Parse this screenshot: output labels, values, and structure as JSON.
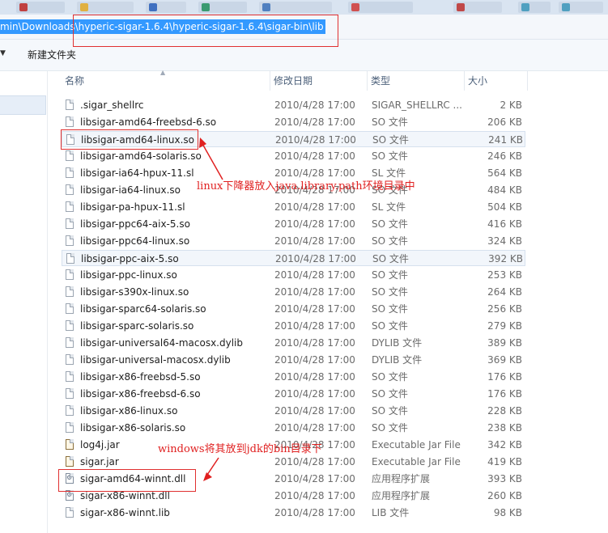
{
  "address": {
    "path": "min\\Downloads\\hyperic-sigar-1.6.4\\hyperic-sigar-1.6.4\\sigar-bin\\lib"
  },
  "toolbar": {
    "new_folder_label": "新建文件夹"
  },
  "columns": {
    "name": "名称",
    "date": "修改日期",
    "type": "类型",
    "size": "大小"
  },
  "files": [
    {
      "name": ".sigar_shellrc",
      "date": "2010/4/28 17:00",
      "type": "SIGAR_SHELLRC ...",
      "size": "2 KB"
    },
    {
      "name": "libsigar-amd64-freebsd-6.so",
      "date": "2010/4/28 17:00",
      "type": "SO 文件",
      "size": "206 KB"
    },
    {
      "name": "libsigar-amd64-linux.so",
      "date": "2010/4/28 17:00",
      "type": "SO 文件",
      "size": "241 KB"
    },
    {
      "name": "libsigar-amd64-solaris.so",
      "date": "2010/4/28 17:00",
      "type": "SO 文件",
      "size": "246 KB"
    },
    {
      "name": "libsigar-ia64-hpux-11.sl",
      "date": "2010/4/28 17:00",
      "type": "SL 文件",
      "size": "564 KB"
    },
    {
      "name": "libsigar-ia64-linux.so",
      "date": "2010/4/28 17:00",
      "type": "SO 文件",
      "size": "484 KB"
    },
    {
      "name": "libsigar-pa-hpux-11.sl",
      "date": "2010/4/28 17:00",
      "type": "SL 文件",
      "size": "504 KB"
    },
    {
      "name": "libsigar-ppc64-aix-5.so",
      "date": "2010/4/28 17:00",
      "type": "SO 文件",
      "size": "416 KB"
    },
    {
      "name": "libsigar-ppc64-linux.so",
      "date": "2010/4/28 17:00",
      "type": "SO 文件",
      "size": "324 KB"
    },
    {
      "name": "libsigar-ppc-aix-5.so",
      "date": "2010/4/28 17:00",
      "type": "SO 文件",
      "size": "392 KB"
    },
    {
      "name": "libsigar-ppc-linux.so",
      "date": "2010/4/28 17:00",
      "type": "SO 文件",
      "size": "253 KB"
    },
    {
      "name": "libsigar-s390x-linux.so",
      "date": "2010/4/28 17:00",
      "type": "SO 文件",
      "size": "264 KB"
    },
    {
      "name": "libsigar-sparc64-solaris.so",
      "date": "2010/4/28 17:00",
      "type": "SO 文件",
      "size": "256 KB"
    },
    {
      "name": "libsigar-sparc-solaris.so",
      "date": "2010/4/28 17:00",
      "type": "SO 文件",
      "size": "279 KB"
    },
    {
      "name": "libsigar-universal64-macosx.dylib",
      "date": "2010/4/28 17:00",
      "type": "DYLIB 文件",
      "size": "389 KB"
    },
    {
      "name": "libsigar-universal-macosx.dylib",
      "date": "2010/4/28 17:00",
      "type": "DYLIB 文件",
      "size": "369 KB"
    },
    {
      "name": "libsigar-x86-freebsd-5.so",
      "date": "2010/4/28 17:00",
      "type": "SO 文件",
      "size": "176 KB"
    },
    {
      "name": "libsigar-x86-freebsd-6.so",
      "date": "2010/4/28 17:00",
      "type": "SO 文件",
      "size": "176 KB"
    },
    {
      "name": "libsigar-x86-linux.so",
      "date": "2010/4/28 17:00",
      "type": "SO 文件",
      "size": "228 KB"
    },
    {
      "name": "libsigar-x86-solaris.so",
      "date": "2010/4/28 17:00",
      "type": "SO 文件",
      "size": "238 KB"
    },
    {
      "name": "log4j.jar",
      "date": "2010/4/28 17:00",
      "type": "Executable Jar File",
      "size": "342 KB"
    },
    {
      "name": "sigar.jar",
      "date": "2010/4/28 17:00",
      "type": "Executable Jar File",
      "size": "419 KB"
    },
    {
      "name": "sigar-amd64-winnt.dll",
      "date": "2010/4/28 17:00",
      "type": "应用程序扩展",
      "size": "393 KB"
    },
    {
      "name": "sigar-x86-winnt.dll",
      "date": "2010/4/28 17:00",
      "type": "应用程序扩展",
      "size": "260 KB"
    },
    {
      "name": "sigar-x86-winnt.lib",
      "date": "2010/4/28 17:00",
      "type": "LIB 文件",
      "size": "98 KB"
    }
  ],
  "annotations": {
    "linux_note": "linux下降器放入java.library.path环境目录中",
    "windows_note": "windows将其放到jdk的bin目录下"
  },
  "colors": {
    "annotation_red": "#e02020",
    "address_highlight": "#3399ff"
  }
}
